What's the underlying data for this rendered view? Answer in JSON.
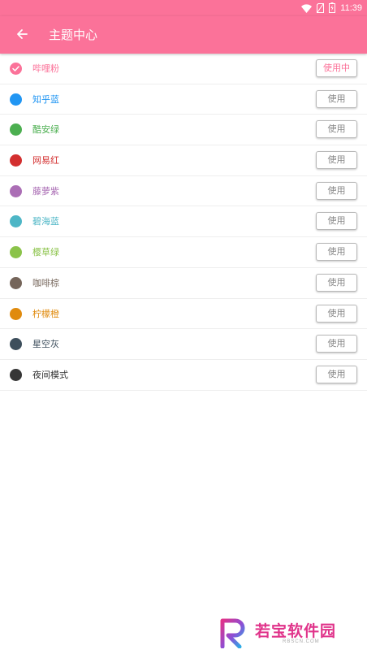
{
  "status_bar": {
    "time": "11:39",
    "icons": [
      "wifi-icon",
      "sim-card-icon",
      "battery-icon"
    ]
  },
  "toolbar": {
    "title": "主题中心",
    "back_icon": "arrow-left-icon"
  },
  "themes": [
    {
      "name": "哔哩粉",
      "color": "#fb7299",
      "button": "使用中",
      "selected": true
    },
    {
      "name": "知乎蓝",
      "color": "#2196f3",
      "button": "使用",
      "selected": false
    },
    {
      "name": "酷安绿",
      "color": "#4caf50",
      "button": "使用",
      "selected": false
    },
    {
      "name": "网易红",
      "color": "#d32f2f",
      "button": "使用",
      "selected": false
    },
    {
      "name": "藤萝紫",
      "color": "#ab6eb5",
      "button": "使用",
      "selected": false
    },
    {
      "name": "碧海蓝",
      "color": "#4db6c6",
      "button": "使用",
      "selected": false
    },
    {
      "name": "樱草绿",
      "color": "#8bc34a",
      "button": "使用",
      "selected": false
    },
    {
      "name": "咖啡棕",
      "color": "#75655a",
      "button": "使用",
      "selected": false
    },
    {
      "name": "柠檬橙",
      "color": "#e08b0e",
      "button": "使用",
      "selected": false
    },
    {
      "name": "星空灰",
      "color": "#3d4e5c",
      "button": "使用",
      "selected": false
    },
    {
      "name": "夜间模式",
      "color": "#363636",
      "button": "使用",
      "selected": false
    }
  ],
  "colors": {
    "accent": "#fb7299",
    "night_text": "#333333"
  },
  "watermark": {
    "text": "若宝软件园",
    "subtext": "RBSCN.COM"
  }
}
